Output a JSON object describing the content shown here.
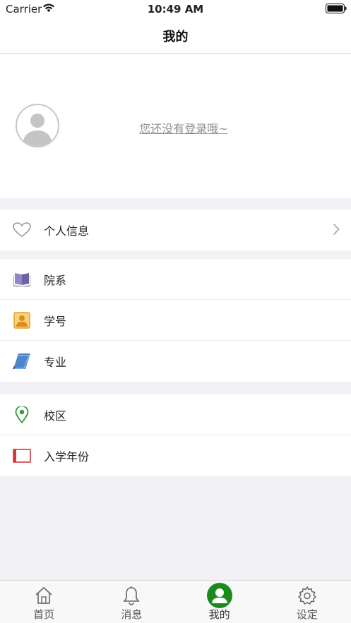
{
  "status_bar": {
    "carrier": "Carrier",
    "time": "10:49 AM"
  },
  "nav": {
    "title": "我的"
  },
  "profile": {
    "login_prompt": "您还没有登录哦~"
  },
  "groups": [
    {
      "items": [
        {
          "label": "个人信息"
        }
      ]
    },
    {
      "items": [
        {
          "label": "院系"
        },
        {
          "label": "学号"
        },
        {
          "label": "专业"
        }
      ]
    },
    {
      "items": [
        {
          "label": "校区"
        },
        {
          "label": "入学年份"
        }
      ]
    }
  ],
  "tabs": [
    {
      "label": "首页",
      "icon": "home-icon"
    },
    {
      "label": "消息",
      "icon": "bell-icon"
    },
    {
      "label": "我的",
      "icon": "user-icon",
      "active": true
    },
    {
      "label": "设定",
      "icon": "gear-icon"
    }
  ],
  "colors": {
    "accent": "#1a8a1a",
    "separator": "#f2f1f6"
  }
}
